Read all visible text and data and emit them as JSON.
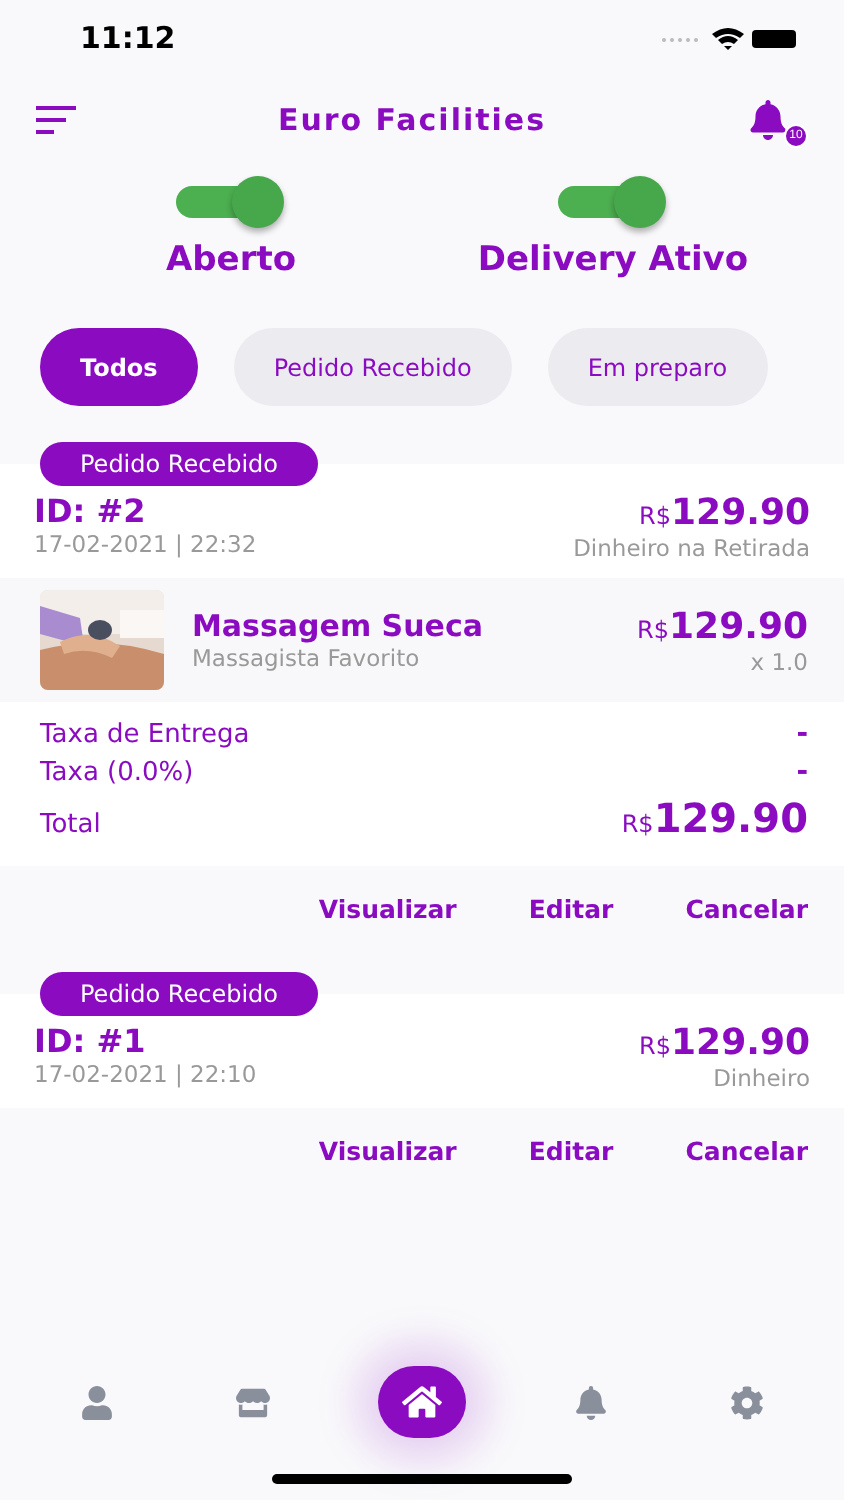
{
  "status_bar": {
    "time": "11:12"
  },
  "header": {
    "title": "Euro Facilities",
    "notification_count": "10"
  },
  "toggles": [
    {
      "label": "Aberto",
      "on": true
    },
    {
      "label": "Delivery Ativo",
      "on": true
    }
  ],
  "filters": [
    {
      "label": "Todos",
      "selected": true
    },
    {
      "label": "Pedido Recebido",
      "selected": false
    },
    {
      "label": "Em preparo",
      "selected": false
    }
  ],
  "orders": [
    {
      "status": "Pedido Recebido",
      "id": "ID: #2",
      "date": "17-02-2021 | 22:32",
      "currency": "R$",
      "amount": "129.90",
      "payment": "Dinheiro na Retirada",
      "items": [
        {
          "kind": "picture",
          "name": "Massagem Sueca",
          "provider": "Massagista Favorito",
          "currency": "R$",
          "amount": "129.90",
          "quantity": "x 1.0"
        }
      ],
      "fees": [
        {
          "label": "Taxa de Entrega",
          "value": "-"
        },
        {
          "label": "Taxa (0.0%)",
          "value": "-"
        }
      ],
      "total": {
        "label": "Total",
        "currency": "R$",
        "amount": "129.90"
      },
      "actions": [
        "Visualizar",
        "Editar",
        "Cancelar"
      ]
    },
    {
      "status": "Pedido Recebido",
      "id": "ID: #1",
      "date": "17-02-2021 | 22:10",
      "currency": "R$",
      "amount": "129.90",
      "payment": "Dinheiro",
      "actions": [
        "Visualizar",
        "Editar",
        "Cancelar"
      ]
    }
  ],
  "bottom_nav": [
    {
      "kind": "profile",
      "selected": false
    },
    {
      "kind": "store",
      "selected": false
    },
    {
      "kind": "home",
      "selected": true
    },
    {
      "kind": "notifications",
      "selected": false
    },
    {
      "kind": "settings",
      "selected": false
    }
  ]
}
